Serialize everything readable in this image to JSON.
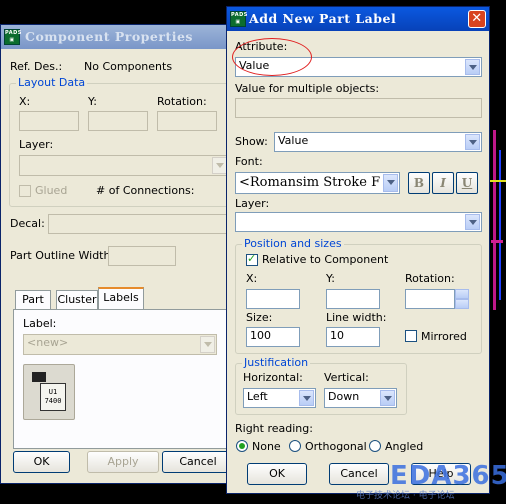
{
  "component_window": {
    "title": "Component Properties",
    "ref_des_label": "Ref. Des.:",
    "ref_des_value": "No Components",
    "layout_data_label": "Layout Data",
    "x_label": "X:",
    "y_label": "Y:",
    "rotation_label": "Rotation:",
    "layer_label": "Layer:",
    "glued_label": "Glued",
    "connections_label": "# of Connections:",
    "decal_label": "Decal:",
    "outline_width_label": "Part Outline Width:",
    "tabs": [
      "Part",
      "Cluster",
      "Labels"
    ],
    "label_label": "Label:",
    "label_value": "<new>",
    "ok": "OK",
    "apply": "Apply",
    "cancel": "Cancel",
    "icon_text_1": "U1",
    "icon_text_2": "7400"
  },
  "label_window": {
    "title": "Add New Part Label",
    "attribute_label": "Attribute:",
    "attribute_value": "Value",
    "multi_label": "Value for multiple objects:",
    "show_label": "Show:",
    "show_value": "Value",
    "font_label": "Font:",
    "font_value": "<Romansim Stroke F",
    "font_bold": "B",
    "font_italic": "I",
    "font_underline": "U",
    "layer_label": "Layer:",
    "position_group": "Position and sizes",
    "relative_label": "Relative to Component",
    "x_label": "X:",
    "y_label": "Y:",
    "rotation_label": "Rotation:",
    "size_label": "Size:",
    "size_value": "100",
    "line_width_label": "Line width:",
    "line_width_value": "10",
    "mirrored_label": "Mirrored",
    "justification_group": "Justification",
    "horizontal_label": "Horizontal:",
    "horizontal_value": "Left",
    "vertical_label": "Vertical:",
    "vertical_value": "Down",
    "right_reading_label": "Right reading:",
    "rr_none": "None",
    "rr_orthogonal": "Orthogonal",
    "rr_angled": "Angled",
    "ok": "OK",
    "cancel": "Cancel",
    "help": "Help"
  },
  "watermark": {
    "brand": "EDA365",
    "subtitle": "电子技术论坛 · 电子论坛"
  },
  "colors": {
    "title_active": "#0a58e0",
    "highlight_ellipse": "#e02020",
    "group_label": "#0046d5",
    "close_button": "#d8431f"
  }
}
